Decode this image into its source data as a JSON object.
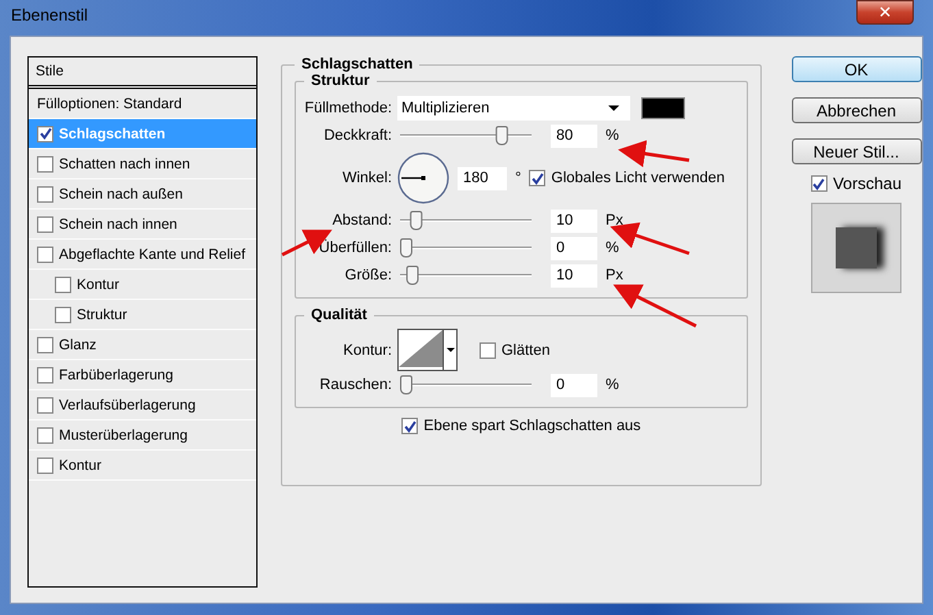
{
  "window": {
    "title": "Ebenenstil",
    "close": "✕"
  },
  "styles": {
    "header": "Stile",
    "items": [
      {
        "label": "Fülloptionen: Standard",
        "kind": "plain",
        "selected": false
      },
      {
        "label": "Schlagschatten",
        "kind": "effect",
        "checked": true,
        "selected": true
      },
      {
        "label": "Schatten nach innen",
        "kind": "effect",
        "checked": false,
        "selected": false
      },
      {
        "label": "Schein nach außen",
        "kind": "effect",
        "checked": false,
        "selected": false
      },
      {
        "label": "Schein nach innen",
        "kind": "effect",
        "checked": false,
        "selected": false
      },
      {
        "label": "Abgeflachte Kante und Relief",
        "kind": "effect",
        "checked": false,
        "selected": false,
        "children": [
          {
            "label": "Kontur",
            "kind": "effect",
            "checked": false,
            "selected": false
          },
          {
            "label": "Struktur",
            "kind": "effect",
            "checked": false,
            "selected": false
          }
        ]
      },
      {
        "label": "Glanz",
        "kind": "effect",
        "checked": false,
        "selected": false
      },
      {
        "label": "Farbüberlagerung",
        "kind": "effect",
        "checked": false,
        "selected": false
      },
      {
        "label": "Verlaufsüberlagerung",
        "kind": "effect",
        "checked": false,
        "selected": false
      },
      {
        "label": "Musterüberlagerung",
        "kind": "effect",
        "checked": false,
        "selected": false
      },
      {
        "label": "Kontur",
        "kind": "effect",
        "checked": false,
        "selected": false
      }
    ]
  },
  "drop_shadow": {
    "title": "Schlagschatten",
    "structure": {
      "title": "Struktur",
      "blend_mode": {
        "label": "Füllmethode:",
        "value": "Multiplizieren"
      },
      "opacity": {
        "label": "Deckkraft:",
        "level": 0.8,
        "value": "80",
        "unit": "%"
      },
      "angle": {
        "label": "Winkel:",
        "value": "180",
        "unit": "°"
      },
      "global_light": {
        "label": "Globales Licht verwenden",
        "checked": true
      },
      "distance": {
        "label": "Abstand:",
        "level": 0.08,
        "value": "10",
        "unit": "Px"
      },
      "spread": {
        "label": "Überfüllen:",
        "level": 0,
        "value": "0",
        "unit": "%"
      },
      "size": {
        "label": "Größe:",
        "level": 0.05,
        "value": "10",
        "unit": "Px"
      }
    },
    "quality": {
      "title": "Qualität",
      "contour": {
        "label": "Kontur:"
      },
      "anti_alias": {
        "label": "Glätten",
        "checked": false
      },
      "noise": {
        "label": "Rauschen:",
        "level": 0,
        "value": "0",
        "unit": "%"
      }
    },
    "knockout": {
      "label": "Ebene spart Schlagschatten aus",
      "checked": true
    }
  },
  "buttons": [
    {
      "label": "OK",
      "default": true
    },
    {
      "label": "Abbrechen",
      "default": false
    },
    {
      "label": "Neuer Stil...",
      "default": false
    }
  ],
  "preview": {
    "label": "Vorschau",
    "checked": true
  }
}
